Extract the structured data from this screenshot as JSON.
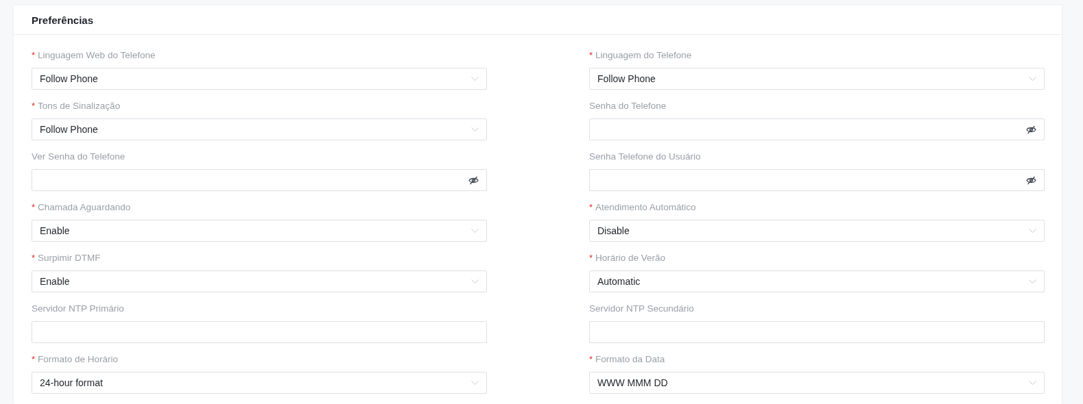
{
  "panel": {
    "title": "Preferências"
  },
  "fields": [
    {
      "kind": "select",
      "required_mark": "*",
      "label": "Linguagem Web do Telefone",
      "value": "Follow Phone"
    },
    {
      "kind": "select",
      "required_mark": "*",
      "label": "Linguagem do Telefone",
      "value": "Follow Phone"
    },
    {
      "kind": "select",
      "required_mark": "*",
      "label": "Tons de Sinalização",
      "value": "Follow Phone"
    },
    {
      "kind": "password",
      "label": "Senha do Telefone"
    },
    {
      "kind": "password",
      "label": "Ver Senha do Telefone"
    },
    {
      "kind": "password",
      "label": "Senha Telefone do Usuário"
    },
    {
      "kind": "select",
      "required_mark": "*",
      "label": "Chamada Aguardando",
      "value": "Enable"
    },
    {
      "kind": "select",
      "required_mark": "*",
      "label": "Atendimento Automático",
      "value": "Disable"
    },
    {
      "kind": "select",
      "required_mark": "*",
      "label": "Surpimir DTMF",
      "value": "Enable"
    },
    {
      "kind": "select",
      "required_mark": "*",
      "label": "Horário de Verão",
      "value": "Automatic"
    },
    {
      "kind": "text",
      "label": "Servidor NTP Primário"
    },
    {
      "kind": "text",
      "label": "Servidor NTP Secundário"
    },
    {
      "kind": "select",
      "required_mark": "*",
      "label": "Formato de Horário",
      "value": "24-hour format"
    },
    {
      "kind": "select",
      "required_mark": "*",
      "label": "Formato da Data",
      "value": "WWW MMM DD"
    }
  ]
}
